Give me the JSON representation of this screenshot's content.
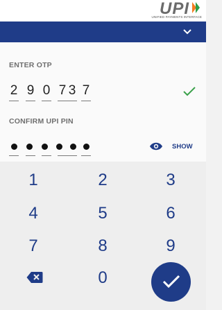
{
  "header": {
    "logo_text": "UPI",
    "logo_subtitle": "UNIFIED PAYMENTS INTERFACE",
    "accent": "#1f3c88"
  },
  "otp": {
    "label": "ENTER OTP",
    "digits": [
      "2",
      "9",
      "0",
      "7",
      "3",
      "7"
    ],
    "status_icon": "check-icon"
  },
  "pin": {
    "label": "CONFIRM UPI PIN",
    "masked_length": 6,
    "show_label": "SHOW"
  },
  "keypad": {
    "keys": [
      "1",
      "2",
      "3",
      "4",
      "5",
      "6",
      "7",
      "8",
      "9",
      "0"
    ],
    "backspace_icon": "backspace-icon",
    "submit_icon": "check-icon"
  }
}
